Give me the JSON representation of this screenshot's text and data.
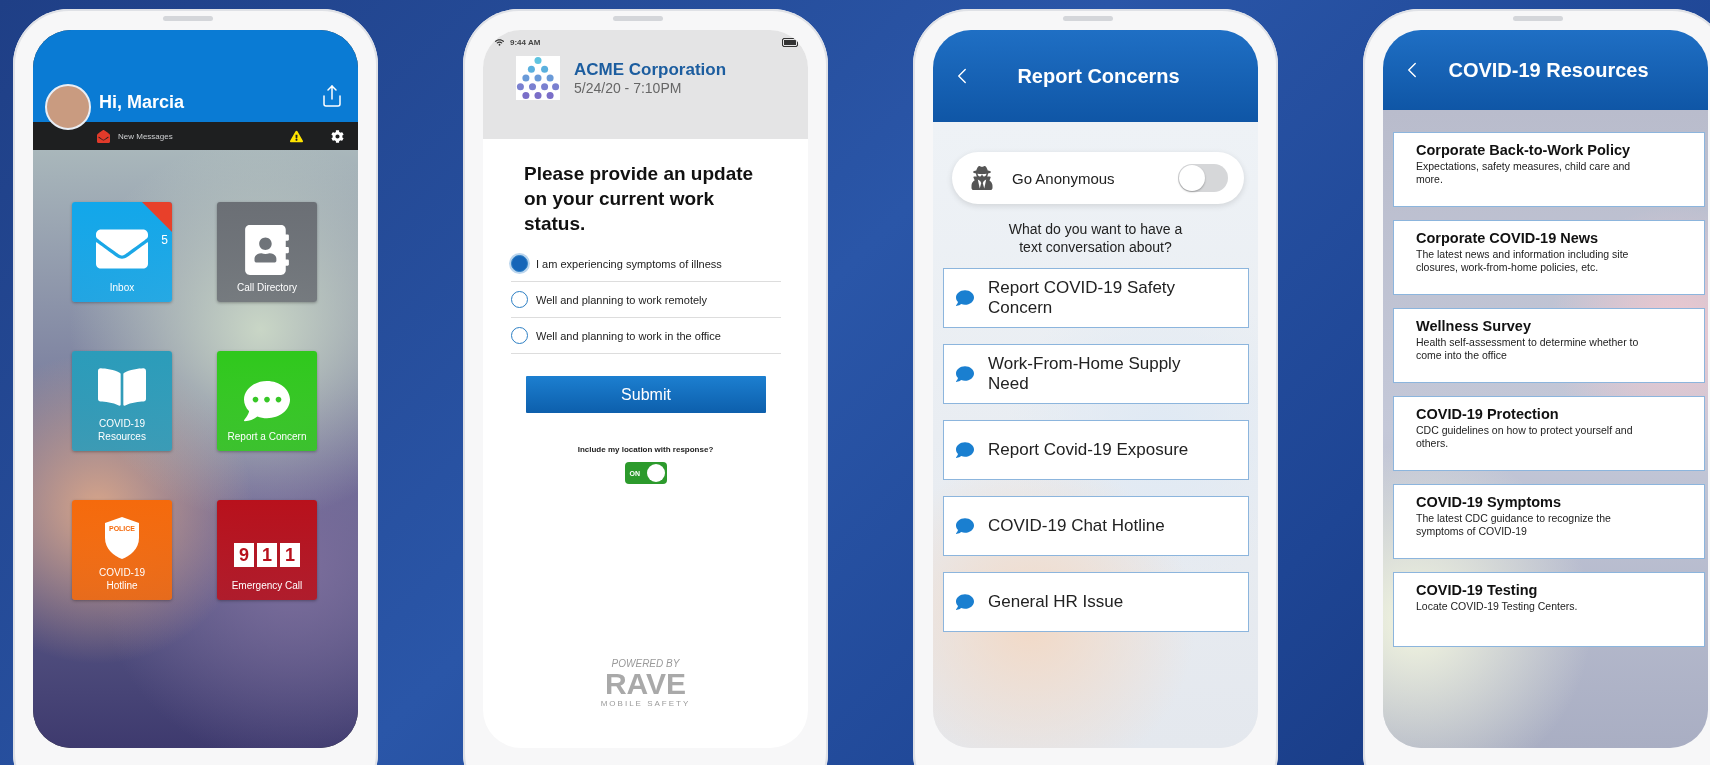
{
  "phones": [
    {
      "kind": "home",
      "greeting": "Hi, Marcia",
      "notice": "New Messages",
      "tiles": [
        {
          "kind": "inbox",
          "label": "Inbox",
          "badge": "5",
          "color": "#12a7ea"
        },
        {
          "kind": "directory",
          "label": "Call Directory",
          "color": "#6b6f75"
        },
        {
          "kind": "book",
          "label": "COVID-19 Resources",
          "color": "#2b9cba"
        },
        {
          "kind": "chat",
          "label": "Report a Concern",
          "color": "#2fc81c"
        },
        {
          "kind": "police",
          "label": "COVID-19 Hotline",
          "emblem": "POLICE",
          "color": "#f56a0c"
        },
        {
          "kind": "digits",
          "label": "Emergency Call",
          "digits": [
            "9",
            "1",
            "1"
          ],
          "color": "#b8111c"
        }
      ]
    },
    {
      "kind": "survey",
      "time": "9:44 AM",
      "company": "ACME Corporation",
      "timestamp": "5/24/20 - 7:10PM",
      "question": "Please provide an update on your current work status.",
      "options": [
        {
          "label": "I am experiencing symptoms of illness",
          "selected": true
        },
        {
          "label": "Well and planning to work remotely",
          "selected": false
        },
        {
          "label": "Well and planning to work in the office",
          "selected": false
        }
      ],
      "submit": "Submit",
      "location_prompt": "Include my location with response?",
      "location_toggle": {
        "label": "ON",
        "on": true
      },
      "powered_by": "POWERED BY",
      "brand": "RAVE",
      "brand_tagline": "MOBILE SAFETY"
    },
    {
      "kind": "concerns",
      "title": "Report Concerns",
      "anonymous": {
        "label": "Go Anonymous",
        "on": false
      },
      "prompt": "What do you want to have a text conversation about?",
      "options": [
        "Report COVID-19 Safety Concern",
        "Work-From-Home Supply Need",
        "Report Covid-19 Exposure",
        "COVID-19 Chat Hotline",
        "General HR Issue"
      ]
    },
    {
      "kind": "resources",
      "title": "COVID-19 Resources",
      "items": [
        {
          "title": "Corporate Back-to-Work Policy",
          "description": "Expectations, safety measures, child care and more."
        },
        {
          "title": "Corporate COVID-19 News",
          "description": "The latest news and information including site closures, work-from-home policies, etc."
        },
        {
          "title": "Wellness Survey",
          "description": "Health self-assessment to determine whether to come into the office"
        },
        {
          "title": "COVID-19 Protection",
          "description": "CDC guidelines on how to protect yourself and others."
        },
        {
          "title": "COVID-19 Symptoms",
          "description": "The latest CDC guidance to recognize the symptoms of COVID-19"
        },
        {
          "title": "COVID-19 Testing",
          "description": "Locate COVID-19 Testing Centers."
        }
      ]
    }
  ]
}
